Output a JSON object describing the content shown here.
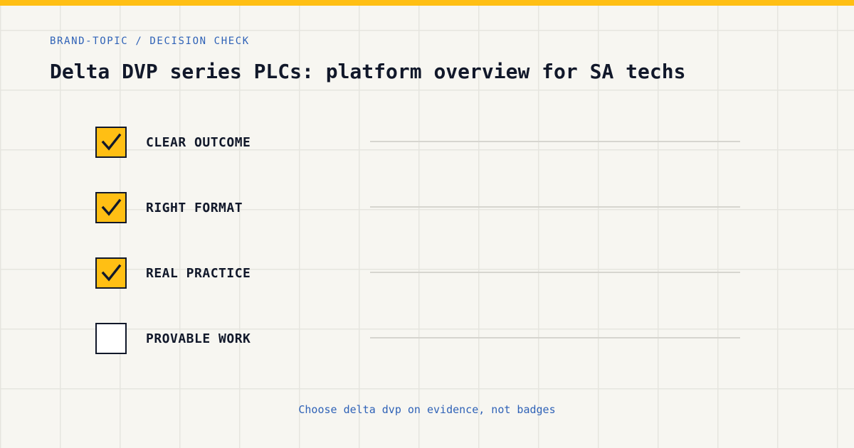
{
  "theme": {
    "accent": "#ffbf14",
    "ink": "#11182a",
    "link_blue": "#2f62b7"
  },
  "eyebrow": "BRAND-TOPIC / DECISION CHECK",
  "title": "Delta DVP series PLCs: platform overview for SA techs",
  "checklist": [
    {
      "label": "CLEAR OUTCOME",
      "checked": true
    },
    {
      "label": "RIGHT FORMAT",
      "checked": true
    },
    {
      "label": "REAL PRACTICE",
      "checked": true
    },
    {
      "label": "PROVABLE WORK",
      "checked": false
    }
  ],
  "footer": "Choose delta dvp on evidence, not badges"
}
